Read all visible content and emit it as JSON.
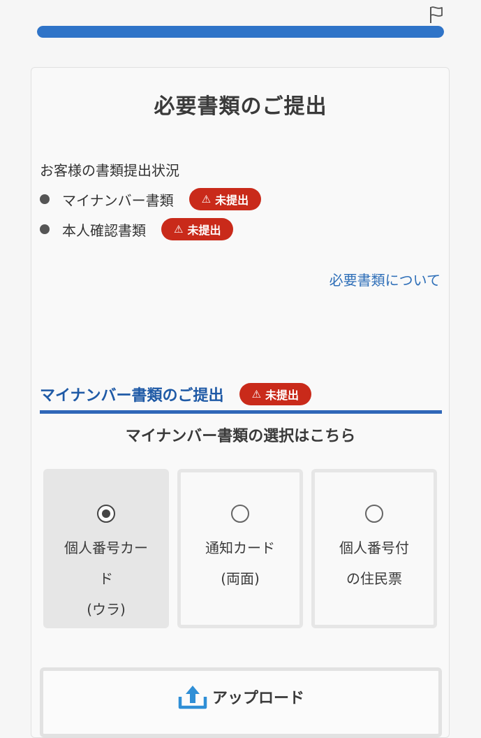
{
  "header": {
    "progress_percent": 100,
    "accent_color": "#2f74c8"
  },
  "page": {
    "title": "必要書類のご提出"
  },
  "status": {
    "heading": "お客様の書類提出状況",
    "items": [
      {
        "name": "マイナンバー書類",
        "badge": "未提出"
      },
      {
        "name": "本人確認書類",
        "badge": "未提出"
      }
    ],
    "badge_color": "#c92a1a",
    "about_link": "必要書類について"
  },
  "mynumber_section": {
    "title": "マイナンバー書類のご提出",
    "badge": "未提出",
    "select_heading": "マイナンバー書類の選択はこちら",
    "options": [
      {
        "lines": [
          "個人番号カー",
          "ド",
          "(ウラ)"
        ],
        "selected": true
      },
      {
        "lines": [
          "通知カード",
          "(両面)"
        ],
        "selected": false
      },
      {
        "lines": [
          "個人番号付",
          "の住民票"
        ],
        "selected": false
      }
    ],
    "upload_label": "アップロード"
  },
  "icons": {
    "flag": "flag-icon",
    "warning": "warning-icon",
    "upload": "upload-icon"
  }
}
